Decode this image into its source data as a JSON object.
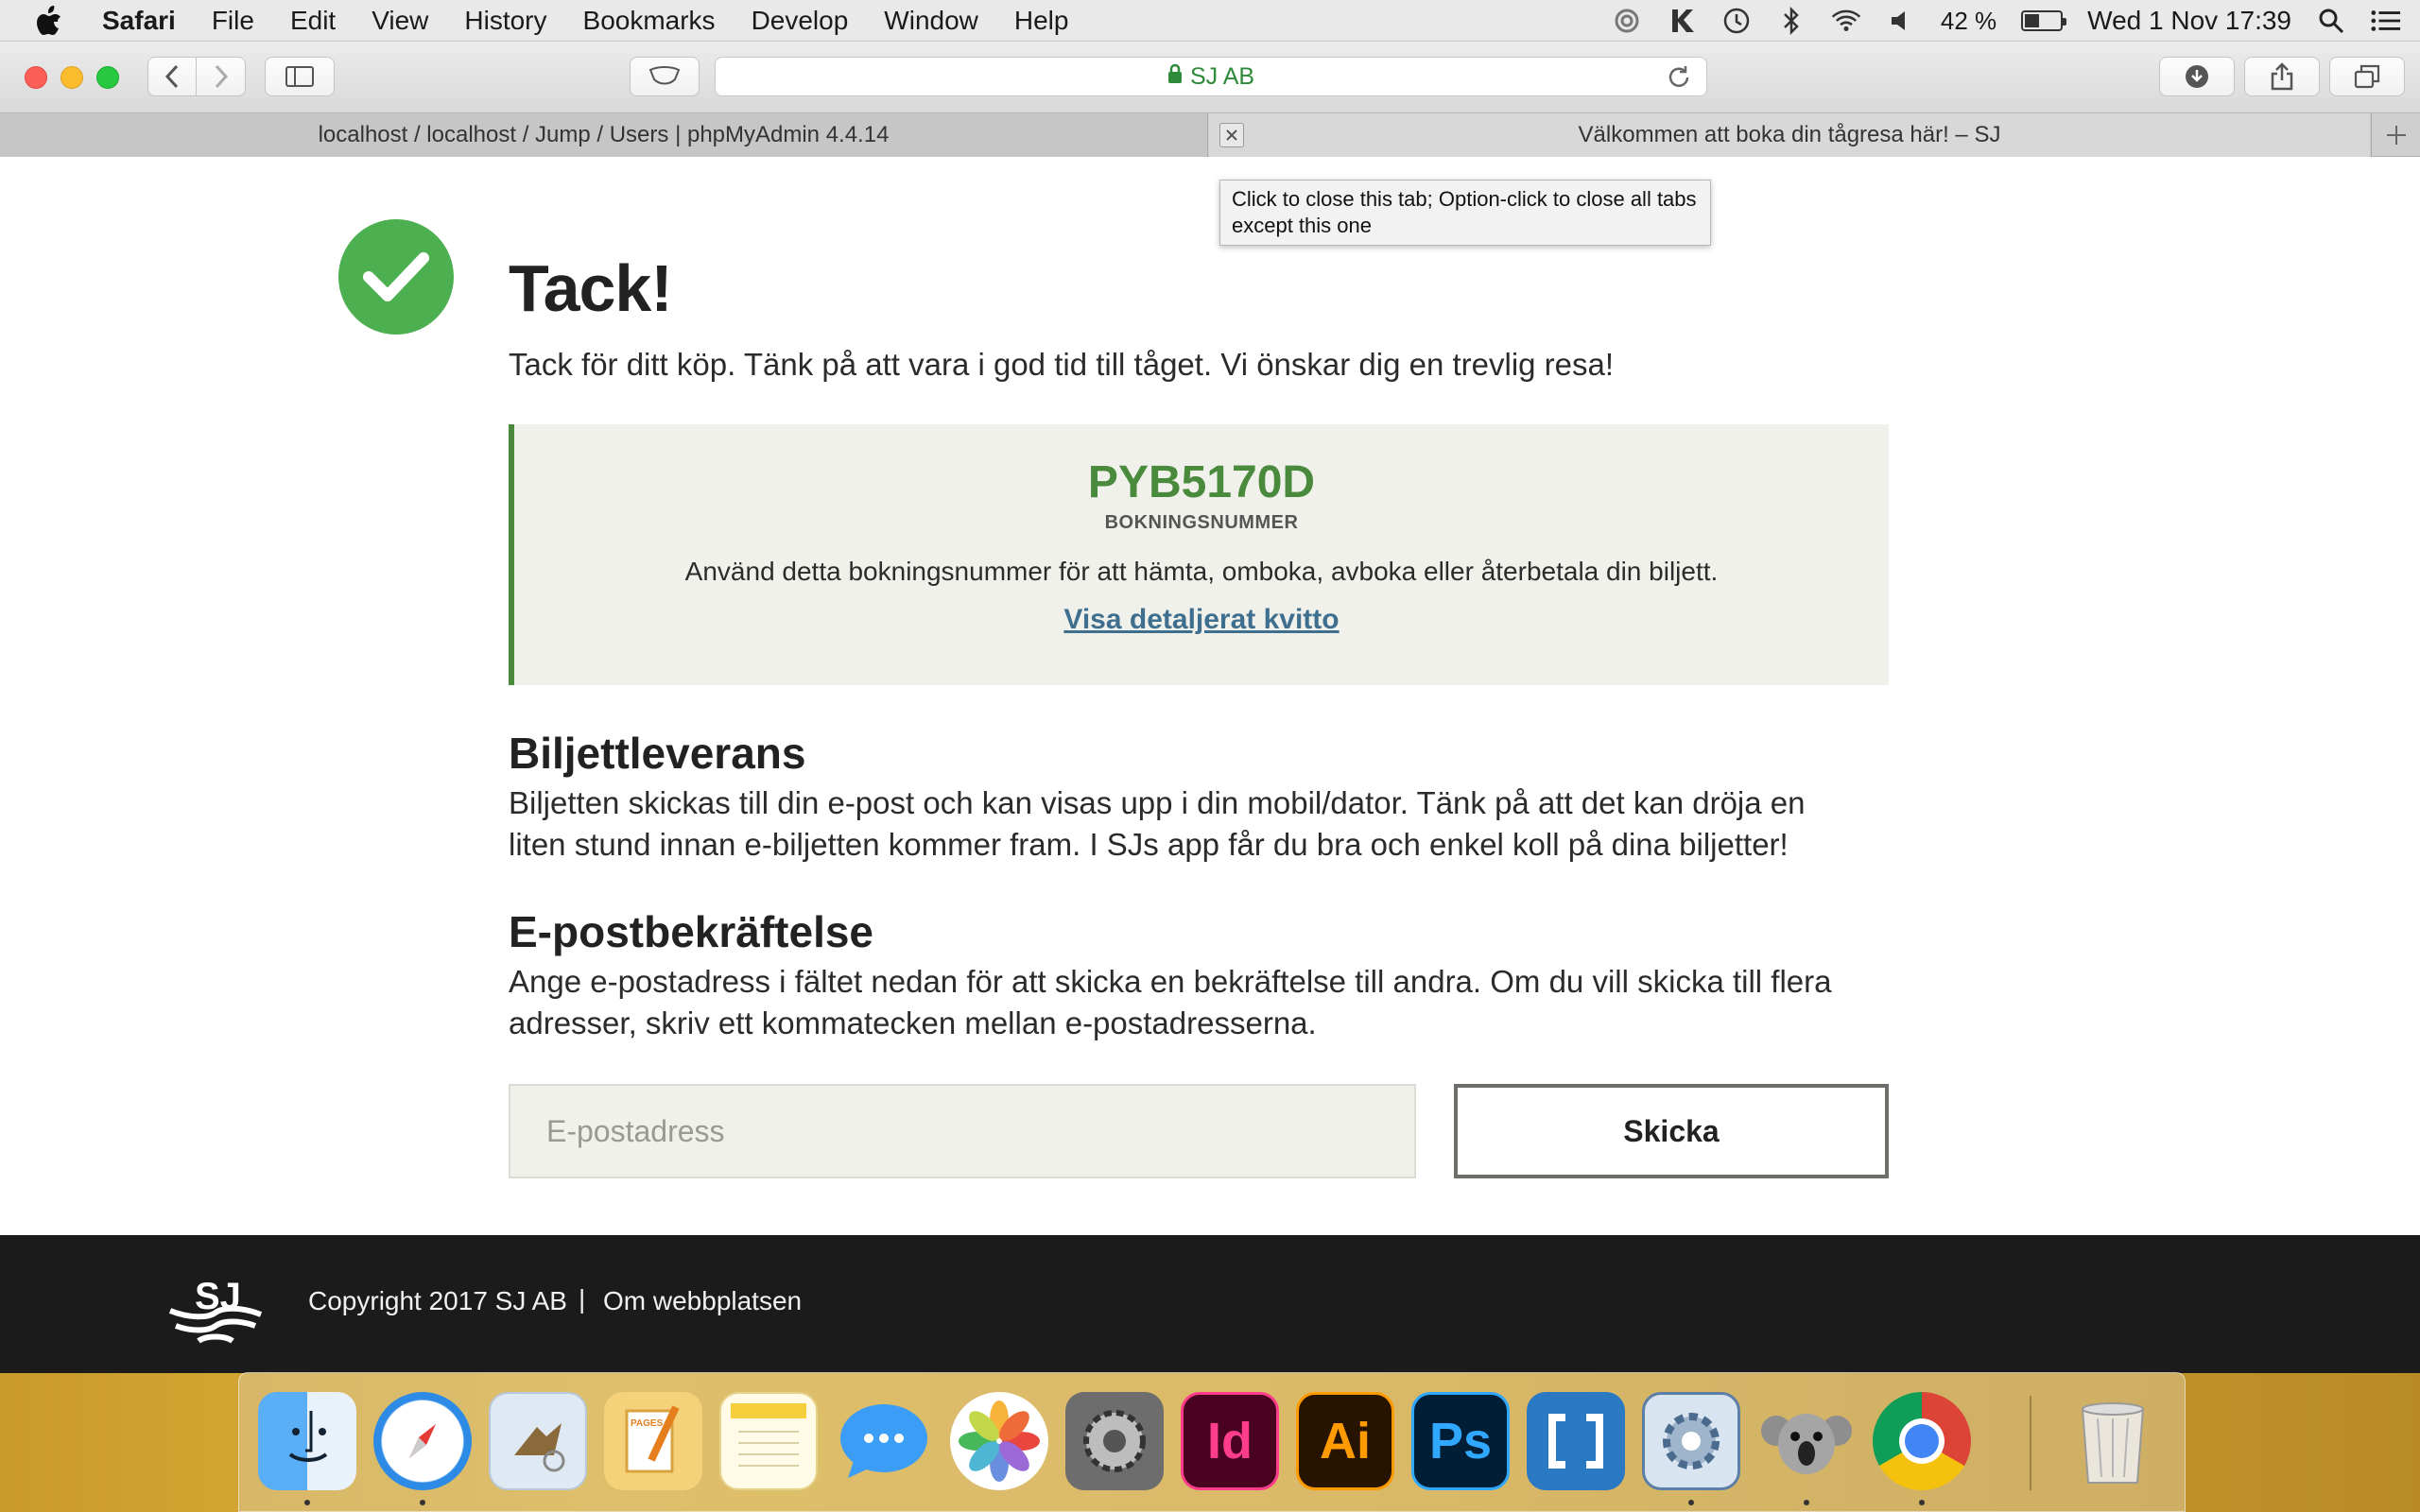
{
  "menubar": {
    "app_name": "Safari",
    "menus": [
      "File",
      "Edit",
      "View",
      "History",
      "Bookmarks",
      "Develop",
      "Window",
      "Help"
    ],
    "battery_percent": "42 %",
    "battery_level": 0.42,
    "datetime": "Wed 1 Nov  17:39",
    "status_icons": [
      "sync-icon",
      "keyboard-k-icon",
      "time-machine-icon",
      "bluetooth-icon",
      "wifi-icon",
      "volume-icon",
      "battery-icon",
      "spotlight-icon",
      "notification-list-icon"
    ]
  },
  "browser": {
    "address": "SJ AB",
    "tabs": [
      {
        "title": "localhost / localhost / Jump / Users | phpMyAdmin 4.4.14",
        "active": false
      },
      {
        "title": "Välkommen att boka din tågresa här! – SJ",
        "active": true
      }
    ],
    "tooltip": "Click to close this tab; Option-click to close all tabs except this one"
  },
  "page": {
    "heading": "Tack!",
    "intro": "Tack för ditt köp. Tänk på att vara i god tid till tåget. Vi önskar dig en trevlig resa!",
    "booking": {
      "code": "PYB5170D",
      "label": "BOKNINGSNUMMER",
      "description": "Använd detta bokningsnummer för att hämta, omboka, avboka eller återbetala din biljett.",
      "receipt_link": "Visa detaljerat kvitto"
    },
    "delivery": {
      "title": "Biljettleverans",
      "line1": "Biljetten skickas till din e-post och kan visas upp i din mobil/dator. Tänk på att det kan dröja en",
      "line2": "liten stund innan e-biljetten kommer fram. I SJs app får du bra och enkel koll på dina biljetter!"
    },
    "email": {
      "title": "E-postbekräftelse",
      "line1": "Ange e-postadress i fältet nedan för att skicka en bekräftelse till andra. Om du vill skicka till flera",
      "line2": "adresser, skriv ett kommatecken mellan e-postadresserna.",
      "placeholder": "E-postadress",
      "value": "",
      "button": "Skicka"
    }
  },
  "footer": {
    "logo_text": "SJ",
    "copyright": "Copyright 2017 SJ AB",
    "separator": "|",
    "about_link": "Om webbplatsen"
  },
  "colors": {
    "success": "#4caf50",
    "booking_code": "#4a8a3c",
    "link": "#3f6f8f",
    "footer_bg": "#1b1b1b",
    "box_bg": "#f1f1ec"
  },
  "dock": {
    "apps": [
      {
        "name": "finder-icon",
        "label": ""
      },
      {
        "name": "safari-icon",
        "label": ""
      },
      {
        "name": "mail-icon",
        "label": ""
      },
      {
        "name": "pages-icon",
        "label": "PAGES"
      },
      {
        "name": "notes-icon",
        "label": ""
      },
      {
        "name": "messages-icon",
        "label": ""
      },
      {
        "name": "photos-icon",
        "label": ""
      },
      {
        "name": "system-preferences-icon",
        "label": ""
      },
      {
        "name": "indesign-icon",
        "label": "Id"
      },
      {
        "name": "illustrator-icon",
        "label": "Ai"
      },
      {
        "name": "photoshop-icon",
        "label": "Ps"
      },
      {
        "name": "brackets-icon",
        "label": ""
      },
      {
        "name": "utility-gear-icon",
        "label": ""
      },
      {
        "name": "koala-icon",
        "label": ""
      },
      {
        "name": "chrome-icon",
        "label": ""
      },
      {
        "name": "trash-icon",
        "label": ""
      }
    ]
  }
}
